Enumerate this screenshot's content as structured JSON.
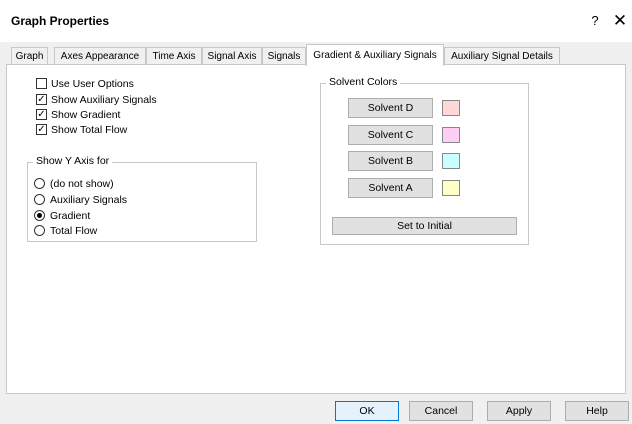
{
  "window": {
    "title": "Graph Properties",
    "help_glyph": "?",
    "close_glyph": "✕"
  },
  "tabs": [
    {
      "label": "Graph"
    },
    {
      "label": "Axes Appearance"
    },
    {
      "label": "Time Axis"
    },
    {
      "label": "Signal Axis"
    },
    {
      "label": "Signals"
    },
    {
      "label": "Gradient & Auxiliary Signals",
      "active": true
    },
    {
      "label": "Auxiliary Signal Details"
    }
  ],
  "options": {
    "use_user_options": {
      "label": "Use User Options",
      "checked": false
    },
    "show_auxiliary_signals": {
      "label": "Show Auxiliary Signals",
      "checked": true
    },
    "show_gradient": {
      "label": "Show Gradient",
      "checked": true
    },
    "show_total_flow": {
      "label": "Show Total Flow",
      "checked": true
    }
  },
  "y_axis": {
    "title": "Show Y Axis for",
    "options": [
      {
        "label": "(do not show)",
        "selected": false
      },
      {
        "label": "Auxiliary Signals",
        "selected": false
      },
      {
        "label": "Gradient",
        "selected": true
      },
      {
        "label": "Total Flow",
        "selected": false
      }
    ]
  },
  "solvent_colors": {
    "title": "Solvent Colors",
    "solvents": [
      {
        "label": "Solvent D",
        "color": "#ffd7d7"
      },
      {
        "label": "Solvent C",
        "color": "#ffcef5"
      },
      {
        "label": "Solvent B",
        "color": "#c8ffff"
      },
      {
        "label": "Solvent A",
        "color": "#ffffc8"
      }
    ],
    "reset_label": "Set to Initial"
  },
  "footer": {
    "ok": "OK",
    "cancel": "Cancel",
    "apply": "Apply",
    "help": "Help"
  }
}
